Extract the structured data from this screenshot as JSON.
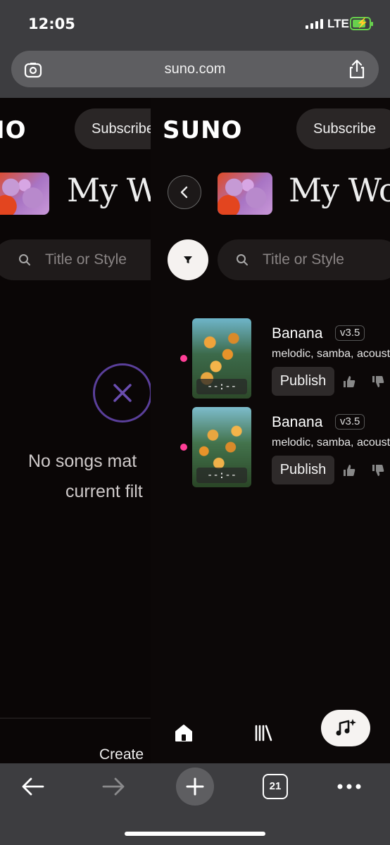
{
  "status_bar": {
    "time": "12:05",
    "network": "LTE"
  },
  "browser": {
    "url": "suno.com",
    "tab_count": "21"
  },
  "back_card": {
    "logo": "IO",
    "subscribe_label": "Subscribe",
    "page_title": "My Wo",
    "search_placeholder": "Title or Style",
    "empty_line1": "No songs mat",
    "empty_line2": "current filt",
    "create_label": "Create"
  },
  "front_card": {
    "logo": "SUNO",
    "subscribe_label": "Subscribe",
    "page_title": "My Work",
    "search_placeholder": "Title or Style",
    "songs": [
      {
        "title": "Banana",
        "version": "v3.5",
        "tags": "melodic, samba, acoustic",
        "duration": "--:--",
        "publish_label": "Publish"
      },
      {
        "title": "Banana",
        "version": "v3.5",
        "tags": "melodic, samba, acoustic",
        "duration": "--:--",
        "publish_label": "Publish"
      }
    ]
  },
  "colors": {
    "accent_dot": "#ff3f97",
    "empty_icon": "#5a3f9a",
    "battery": "#67d04d"
  }
}
